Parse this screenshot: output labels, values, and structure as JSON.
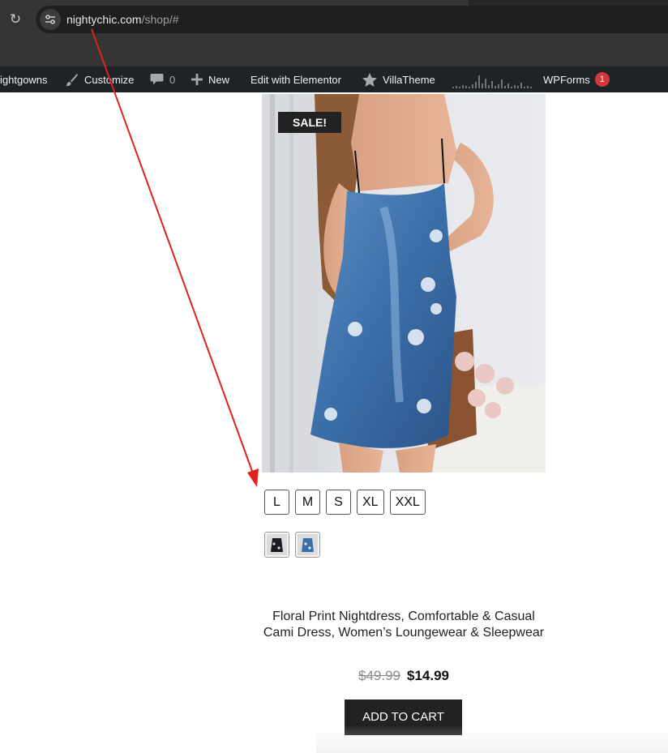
{
  "browser": {
    "url_host": "nightychic.com",
    "url_path": "/shop/#",
    "reload_icon": "reload-icon",
    "site_info_icon": "tune-icon"
  },
  "adminbar": {
    "items": [
      {
        "label": "ightgowns",
        "icon": ""
      },
      {
        "label": "Customize",
        "icon": "brush-icon"
      },
      {
        "label": "0",
        "icon": "comment-icon"
      },
      {
        "label": "New",
        "icon": "plus-icon"
      },
      {
        "label": "Edit with Elementor",
        "icon": ""
      },
      {
        "label": "VillaTheme",
        "icon": "star-icon"
      },
      {
        "label": "WPForms",
        "icon": ""
      }
    ],
    "wpforms_count": "1",
    "colors": {
      "bar": "#1d2327",
      "badge": "#d63638"
    }
  },
  "product": {
    "image_alt": "Woman wearing blue satin floral print cami nightdress",
    "sale_label": "SALE!",
    "sizes": [
      "L",
      "M",
      "S",
      "XL",
      "XXL"
    ],
    "swatches": [
      "black-variant-thumbnail",
      "blue-variant-thumbnail"
    ],
    "title": "Floral Print Nightdress, Comfortable & Casual Cami Dress, Women’s Loungewear & Sleepwear",
    "price_old": "$49.99",
    "price_new": "$14.99",
    "add_to_cart": "ADD TO CART"
  },
  "annotation": {
    "color": "#e0231c"
  }
}
